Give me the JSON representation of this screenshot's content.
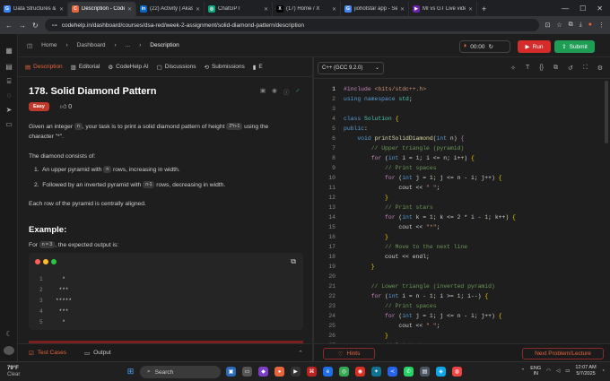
{
  "browser": {
    "tabs": [
      {
        "title": "Data Structures & Al",
        "color": "#3b82f6",
        "glyph": "G",
        "active": false
      },
      {
        "title": "Description - CodeHe",
        "color": "#e8643c",
        "glyph": "C",
        "active": true
      },
      {
        "title": "(22) Activity | Akash",
        "color": "#0a66c2",
        "glyph": "in",
        "active": false
      },
      {
        "title": "ChatGPT",
        "color": "#10a37f",
        "glyph": "◎",
        "active": false
      },
      {
        "title": "(17) Home / X",
        "color": "#000000",
        "glyph": "X",
        "active": false
      },
      {
        "title": "jiohotstar app - Sear",
        "color": "#4285f4",
        "glyph": "G",
        "active": false
      },
      {
        "title": "MI vs GT Live video",
        "color": "#6b21a8",
        "glyph": "▶",
        "active": false
      }
    ],
    "url": "codehelp.in/dashboard/courses/dsa-red/week-2-assignment/solid-diamond-pattern/description"
  },
  "header": {
    "breadcrumb": [
      "Home",
      "Dashboard",
      "...",
      "Description"
    ],
    "timer": "00:00",
    "run_label": "Run",
    "submit_label": "Submit"
  },
  "left_tabs": [
    "Description",
    "Editorial",
    "CodeHelp AI",
    "Discussions",
    "Submissions",
    "E"
  ],
  "problem": {
    "title": "178. Solid Diamond Pattern",
    "difficulty": "Easy",
    "likes": "0",
    "intro_a": "Given an integer ",
    "intro_chip_n": "n",
    "intro_b": ", your task is to print a solid diamond pattern of height ",
    "intro_chip_h": "2*n-1",
    "intro_c": " using the",
    "intro_line2": "character \"*\".",
    "consists": "The diamond consists of:",
    "item1_a": "An upper pyramid with ",
    "item1_chip": "n",
    "item1_b": " rows, increasing in width.",
    "item2_a": "Followed by an inverted pyramid with ",
    "item2_chip": "n-1",
    "item2_b": " rows, decreasing in width.",
    "centered": "Each row of the pyramid is centrally aligned.",
    "example_heading": "Example:",
    "for_a": "For ",
    "for_chip": "n = 3",
    "for_b": ", the expected output is:",
    "output_lines": [
      {
        "n": "1",
        "t": "  *"
      },
      {
        "n": "2",
        "t": " ***"
      },
      {
        "n": "3",
        "t": "*****"
      },
      {
        "n": "4",
        "t": " ***"
      },
      {
        "n": "5",
        "t": "  *"
      }
    ]
  },
  "bottom_tabs": {
    "test_cases": "Test Cases",
    "output": "Output"
  },
  "editor": {
    "language": "C++ (GCC 9.2.0)",
    "hints_label": "Hints",
    "next_label": "Next Problem/Lecture",
    "line_numbers": [
      "1",
      "2",
      "3",
      "4",
      "5",
      "6",
      "7",
      "8",
      "9",
      "10",
      "11",
      "12",
      "13",
      "14",
      "15",
      "16",
      "17",
      "18",
      "19",
      "20",
      "21",
      "22",
      "23",
      "24",
      "25",
      "26",
      "27"
    ]
  },
  "taskbar": {
    "temp": "79°F",
    "weather": "Clear",
    "search": "Search",
    "lang": "ENG",
    "region": "IN",
    "time": "12:07 AM",
    "date": "5/7/2025"
  }
}
